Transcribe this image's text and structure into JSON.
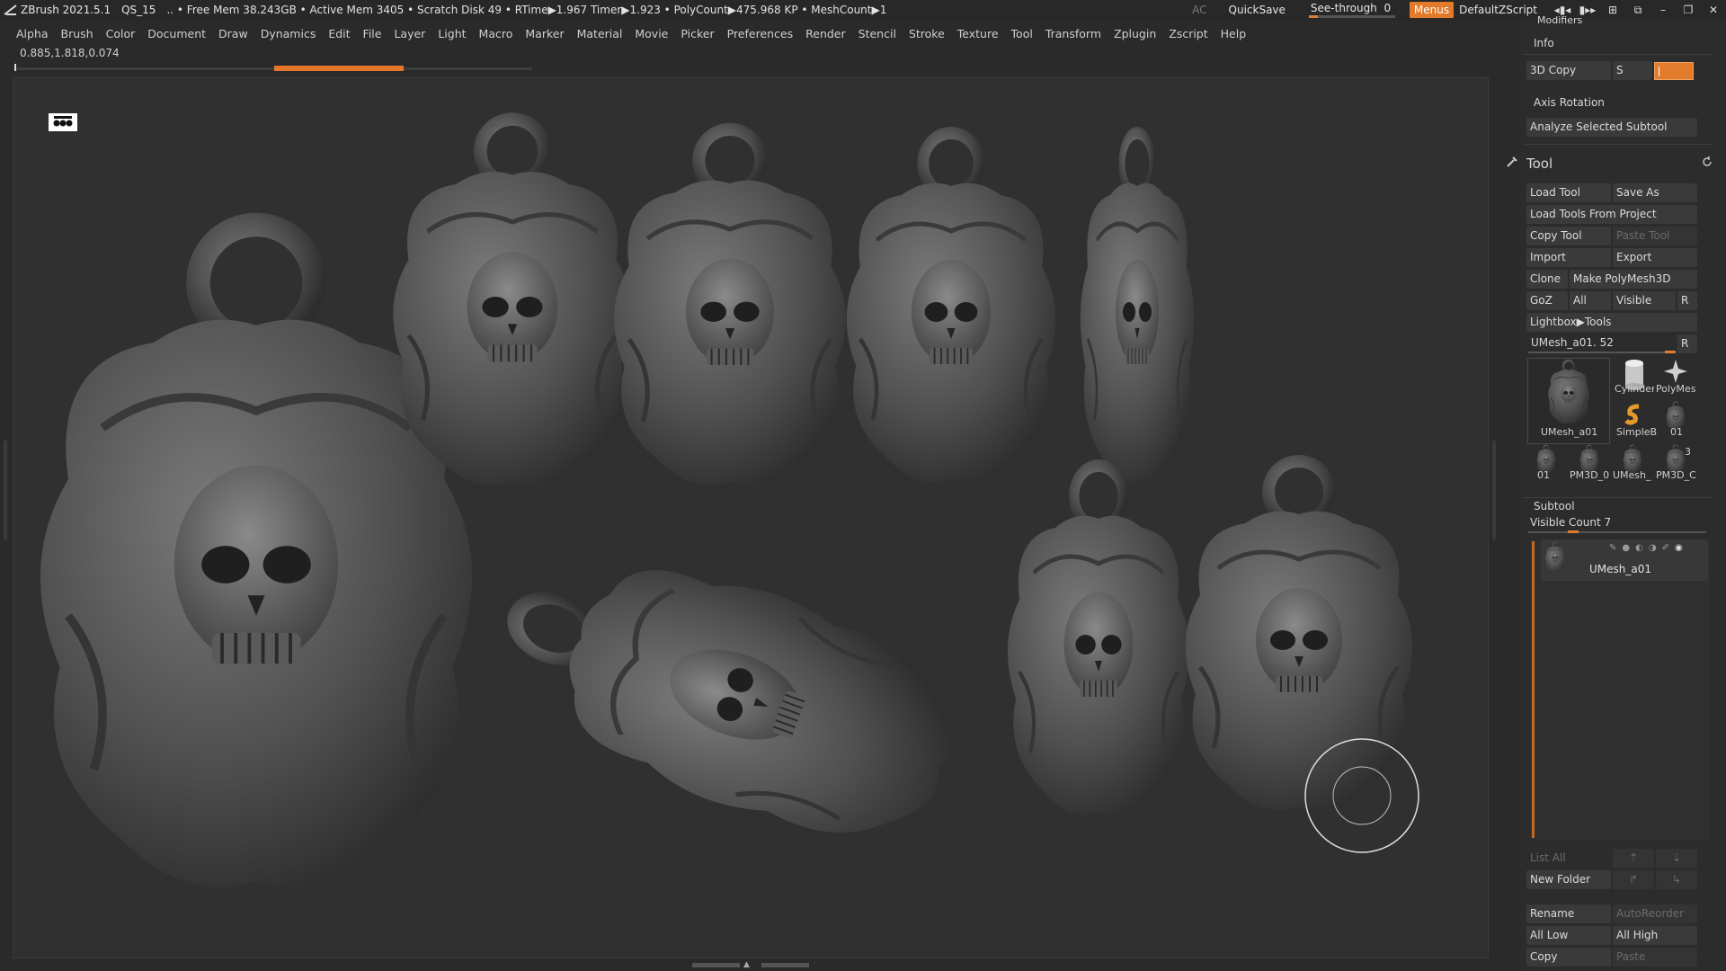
{
  "titlebar": {
    "app": "ZBrush 2021.5.1",
    "project": "QS_15",
    "status": ".. • Free Mem 38.243GB • Active Mem 3405 • Scratch Disk 49 •  RTime▶1.967 Timer▶1.923 • PolyCount▶475.968 KP  • MeshCount▶1",
    "ac": "AC",
    "quicksave": "QuickSave",
    "see_through_label": "See-through",
    "see_through_value": "0",
    "menus": "Menus",
    "script": "DefaultZScript"
  },
  "menubar": {
    "items": [
      "Alpha",
      "Brush",
      "Color",
      "Document",
      "Draw",
      "Dynamics",
      "Edit",
      "File",
      "Layer",
      "Light",
      "Macro",
      "Marker",
      "Material",
      "Movie",
      "Picker",
      "Preferences",
      "Render",
      "Stencil",
      "Stroke",
      "Texture",
      "Tool",
      "Transform",
      "Zplugin",
      "Zscript",
      "Help"
    ]
  },
  "coords": "0.885,1.818,0.074",
  "right_panel": {
    "modifiers": "Modifiers",
    "info": "Info",
    "copy3d": "3D Copy",
    "s_label": "S",
    "axis_rotation": "Axis Rotation",
    "analyze": "Analyze Selected Subtool",
    "tool_title": "Tool",
    "buttons": {
      "load_tool": "Load Tool",
      "save_as": "Save As",
      "load_from_project": "Load Tools From Project",
      "copy_tool": "Copy Tool",
      "paste_tool": "Paste Tool",
      "import": "Import",
      "export": "Export",
      "clone": "Clone",
      "make_polymesh": "Make PolyMesh3D",
      "goz": "GoZ",
      "all": "All",
      "visible": "Visible",
      "r": "R",
      "lightbox_tools": "Lightbox▶Tools"
    },
    "current_tool": "UMesh_a01. 52",
    "current_tool_r": "R",
    "thumbs": {
      "main": "UMesh_a01",
      "cylinder": "Cylinder",
      "polymesh": "PolyMes",
      "simpleb": "SimpleB",
      "t01": "01",
      "row3": [
        "01",
        "PM3D_0",
        "UMesh_",
        "PM3D_C"
      ],
      "row3_badge": "3"
    },
    "subtool": {
      "title": "Subtool",
      "visible_count": "Visible Count 7",
      "item_name": "UMesh_a01",
      "list_all": "List All",
      "new_folder": "New Folder",
      "rename": "Rename",
      "auto_reorder": "AutoReorder",
      "all_low": "All Low",
      "all_high": "All High",
      "copy": "Copy",
      "paste": "Paste"
    }
  },
  "icons": {
    "logo": "zbrush-logo-icon",
    "history": "history-refresh-icon",
    "tool": "tool-wrench-icon",
    "eye": "eye-icon"
  }
}
